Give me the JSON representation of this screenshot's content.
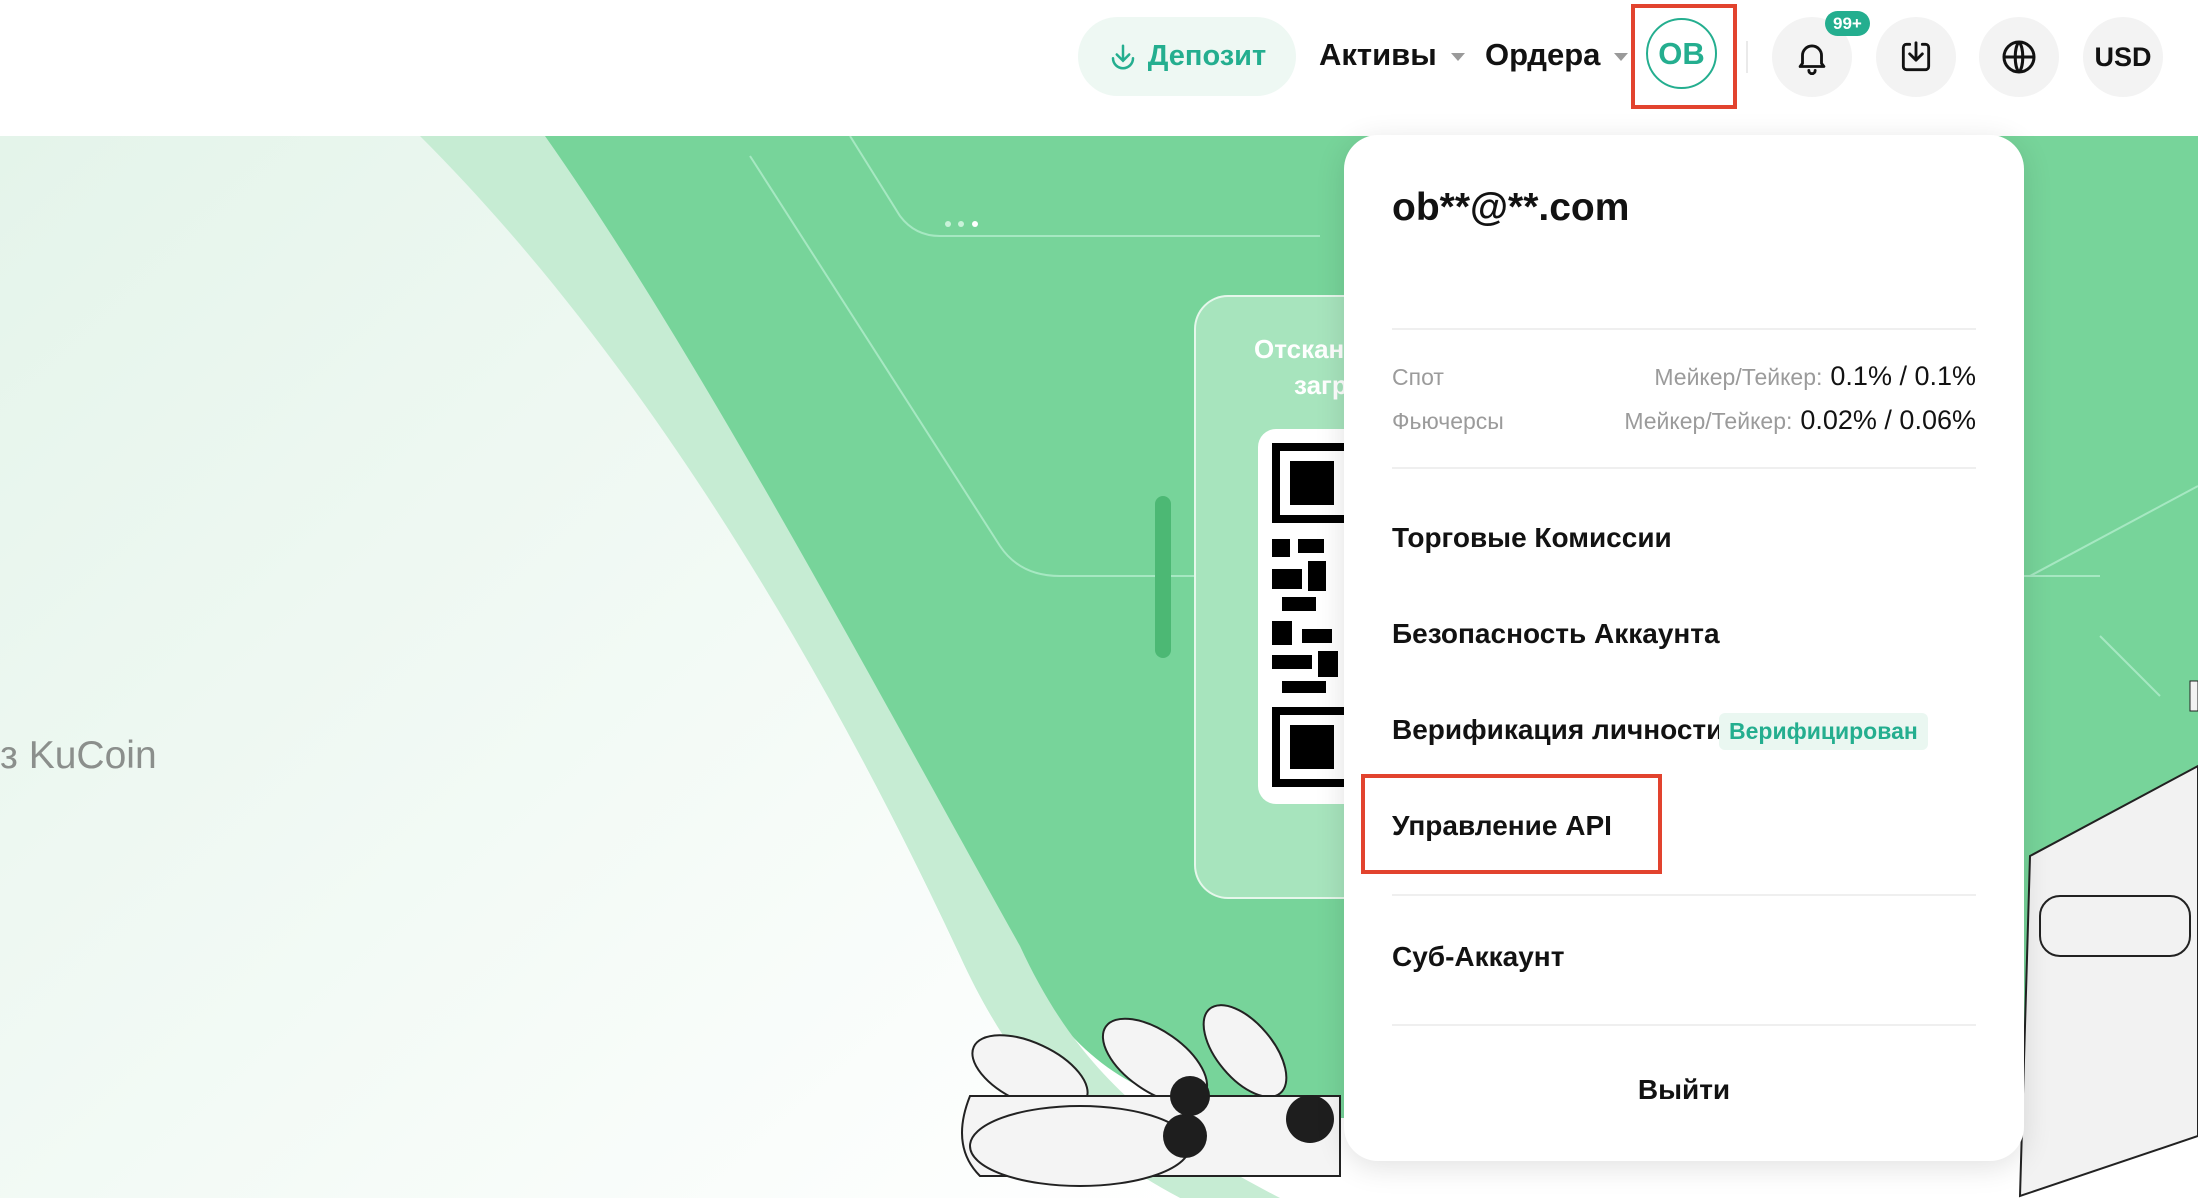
{
  "header": {
    "deposit_label": "Депозит",
    "assets_label": "Активы",
    "orders_label": "Ордера",
    "avatar_initials": "OB",
    "notifications_badge": "99+",
    "currency_label": "USD"
  },
  "hero": {
    "tagline_fragment": "з KuCoin",
    "qr_title_line1": "Отскан",
    "qr_title_line2": "загр"
  },
  "dropdown": {
    "email": "ob**@**.com",
    "fees": [
      {
        "label": "Спот",
        "prefix": "Мейкер/Тейкер:",
        "value": "0.1% / 0.1%"
      },
      {
        "label": "Фьючерсы",
        "prefix": "Мейкер/Тейкер:",
        "value": "0.02% / 0.06%"
      }
    ],
    "menu": {
      "trading_fees": "Торговые Комиссии",
      "account_security": "Безопасность Аккаунта",
      "identity_verification": "Верификация личности",
      "verified_status": "Верифицирован",
      "api_management": "Управление API",
      "sub_account": "Суб-Аккаунт",
      "logout": "Выйти"
    }
  },
  "colors": {
    "accent": "#24ae8f",
    "highlight": "#e2432e",
    "hero_green": "#77d49a"
  },
  "icons": [
    "download-icon",
    "chevron-down-icon",
    "bell-icon",
    "app-download-icon",
    "globe-icon"
  ]
}
